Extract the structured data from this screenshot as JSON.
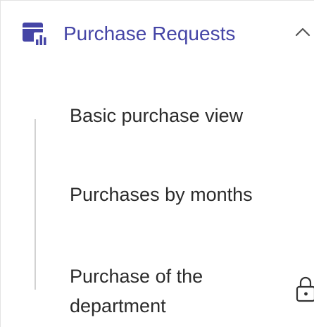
{
  "section": {
    "title": "Purchase Requests",
    "icon": "report-chart-icon",
    "expanded": true,
    "accent_color": "#4545a6"
  },
  "items": [
    {
      "label": "Basic purchase view"
    },
    {
      "label": "Purchases by months"
    },
    {
      "label": "Purchase of the department",
      "locked": true,
      "icon": "lock-icon"
    }
  ]
}
